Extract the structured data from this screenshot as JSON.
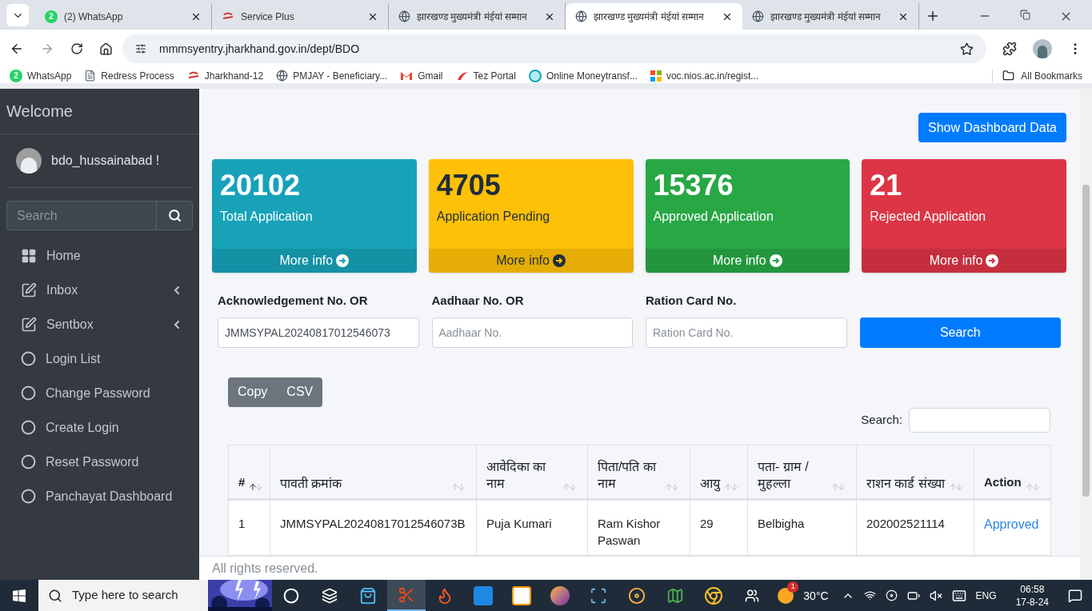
{
  "browser": {
    "tabs": [
      {
        "title": "(2) WhatsApp",
        "kind": "whatsapp",
        "badge": "2",
        "selected": false
      },
      {
        "title": "Service Plus",
        "kind": "sp",
        "selected": false
      },
      {
        "title": "झारखण्ड मुख्यमंत्री मंईयां सम्मान",
        "kind": "globe",
        "selected": false
      },
      {
        "title": "झारखण्ड मुख्यमंत्री मंईयां सम्मान",
        "kind": "globe",
        "selected": true
      },
      {
        "title": "झारखण्ड मुख्यमंत्री मंईयां सम्मान",
        "kind": "globe",
        "selected": false
      }
    ],
    "address": "mmmsyentry.jharkhand.gov.in/dept/BDO",
    "bookmarks": [
      {
        "label": "WhatsApp",
        "kind": "whatsapp",
        "badge": "2"
      },
      {
        "label": "Redress Process",
        "kind": "doc"
      },
      {
        "label": "Jharkhand-12",
        "kind": "sp"
      },
      {
        "label": "PMJAY - Beneficiary...",
        "kind": "globe"
      },
      {
        "label": "Gmail",
        "kind": "gmail"
      },
      {
        "label": "Tez Portal",
        "kind": "tez"
      },
      {
        "label": "Online Moneytransf...",
        "kind": "online"
      },
      {
        "label": "voc.nios.ac.in/regist...",
        "kind": "ms"
      }
    ],
    "all_bookmarks": "All Bookmarks"
  },
  "sidebar": {
    "title": "Welcome",
    "user": "bdo_hussainabad !",
    "search_placeholder": "Search",
    "items": [
      {
        "label": "Home",
        "kind": "grid",
        "expandable": false
      },
      {
        "label": "Inbox",
        "kind": "edit",
        "expandable": true
      },
      {
        "label": "Sentbox",
        "kind": "edit",
        "expandable": true
      },
      {
        "label": "Login List",
        "kind": "circle",
        "expandable": false
      },
      {
        "label": "Change Password",
        "kind": "circle",
        "expandable": false
      },
      {
        "label": "Create Login",
        "kind": "circle",
        "expandable": false
      },
      {
        "label": "Reset Password",
        "kind": "circle",
        "expandable": false
      },
      {
        "label": "Panchayat Dashboard",
        "kind": "circle",
        "expandable": false
      }
    ]
  },
  "dashboard_button": "Show Dashboard Data",
  "cards": [
    {
      "number": "20102",
      "label": "Total Application",
      "more": "More info",
      "color": "#17a2b8"
    },
    {
      "number": "4705",
      "label": "Application Pending",
      "more": "More info",
      "color": "#ffc107"
    },
    {
      "number": "15376",
      "label": "Approved Application",
      "more": "More info",
      "color": "#28a745"
    },
    {
      "number": "21",
      "label": "Rejected Application",
      "more": "More info",
      "color": "#dc3545"
    }
  ],
  "search_form": {
    "fields": [
      {
        "label": "Acknowledgement No. OR",
        "value": "JMMSYPAL20240817012546073"
      },
      {
        "label": "Aadhaar No. OR",
        "placeholder": "Aadhaar No."
      },
      {
        "label": "Ration Card No.",
        "placeholder": "Ration Card No."
      }
    ],
    "button": "Search"
  },
  "export_buttons": [
    "Copy",
    "CSV"
  ],
  "table_search_label": "Search:",
  "table": {
    "columns": [
      {
        "label": "#",
        "sorted": true
      },
      {
        "label": "पावती क्रमांक",
        "sorted": false
      },
      {
        "label": "आवेदिका का नाम",
        "sorted": false
      },
      {
        "label": "पिता/पति का नाम",
        "sorted": false
      },
      {
        "label": "आयु",
        "sorted": false
      },
      {
        "label": "पता- ग्राम / मुहल्ला",
        "sorted": false
      },
      {
        "label": "राशन कार्ड संख्या",
        "sorted": false
      },
      {
        "label": "Action",
        "sorted": false
      }
    ],
    "rows": [
      {
        "cells": [
          "1",
          "JMMSYPAL20240817012546073B",
          "Puja Kumari",
          "Ram Kishor Paswan",
          "29",
          "Belbigha",
          "202002521114"
        ],
        "action": "Approved"
      }
    ]
  },
  "footer": "All rights reserved.",
  "taskbar": {
    "search_placeholder": "Type here to search",
    "apps": [
      {
        "selected": false
      },
      {
        "selected": false
      },
      {
        "selected": false
      },
      {
        "selected": true
      },
      {
        "selected": false
      },
      {
        "selected": false
      },
      {
        "selected": false
      },
      {
        "selected": false
      },
      {
        "selected": false
      },
      {
        "selected": false
      },
      {
        "selected": false
      },
      {
        "selected": false
      }
    ],
    "weather": "30°C",
    "weather_badge": "1",
    "language": "ENG",
    "time": "06:58",
    "date": "17-8-24"
  }
}
